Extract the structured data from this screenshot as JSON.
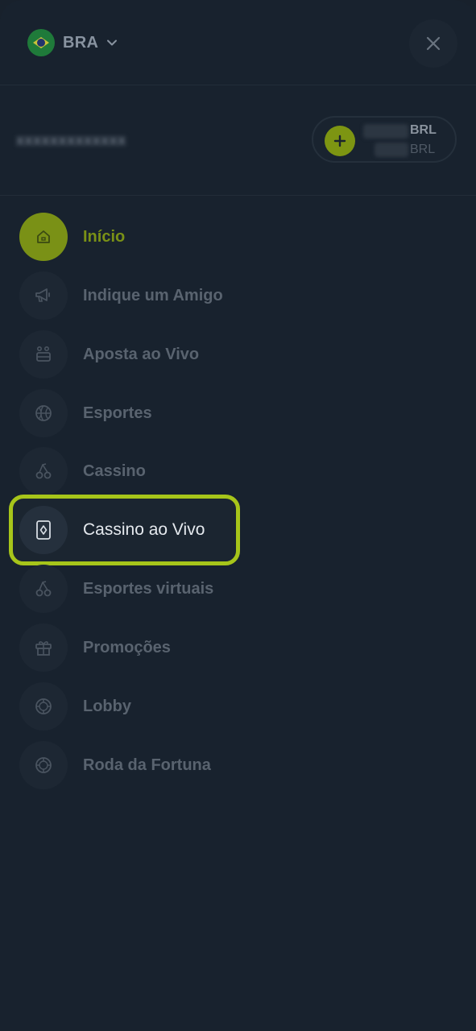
{
  "header": {
    "language_label": "BRA",
    "flag_icon": "brazil-flag-icon",
    "close_icon": "close-icon"
  },
  "user": {
    "balance": [
      {
        "currency": "BRL"
      },
      {
        "currency": "BRL"
      }
    ],
    "deposit_icon": "plus-icon"
  },
  "menu": {
    "items": [
      {
        "label": "Início",
        "icon": "home-icon",
        "state": "active"
      },
      {
        "label": "Indique um Amigo",
        "icon": "megaphone-icon",
        "state": "normal"
      },
      {
        "label": "Aposta ao Vivo",
        "icon": "live-bet-icon",
        "state": "normal"
      },
      {
        "label": "Esportes",
        "icon": "basketball-icon",
        "state": "normal"
      },
      {
        "label": "Cassino",
        "icon": "cherries-icon",
        "state": "normal"
      },
      {
        "label": "Cassino ao Vivo",
        "icon": "playing-card-icon",
        "state": "highlighted"
      },
      {
        "label": "Esportes virtuais",
        "icon": "cherries-icon",
        "state": "normal"
      },
      {
        "label": "Promoções",
        "icon": "gift-icon",
        "state": "normal"
      },
      {
        "label": "Lobby",
        "icon": "chip-icon",
        "state": "normal"
      },
      {
        "label": "Roda da Fortuna",
        "icon": "chip-icon",
        "state": "normal"
      }
    ]
  },
  "colors": {
    "background": "#18222e",
    "accent": "#a7c51a",
    "active_accent": "#7a9116",
    "muted_text": "#59636f"
  }
}
